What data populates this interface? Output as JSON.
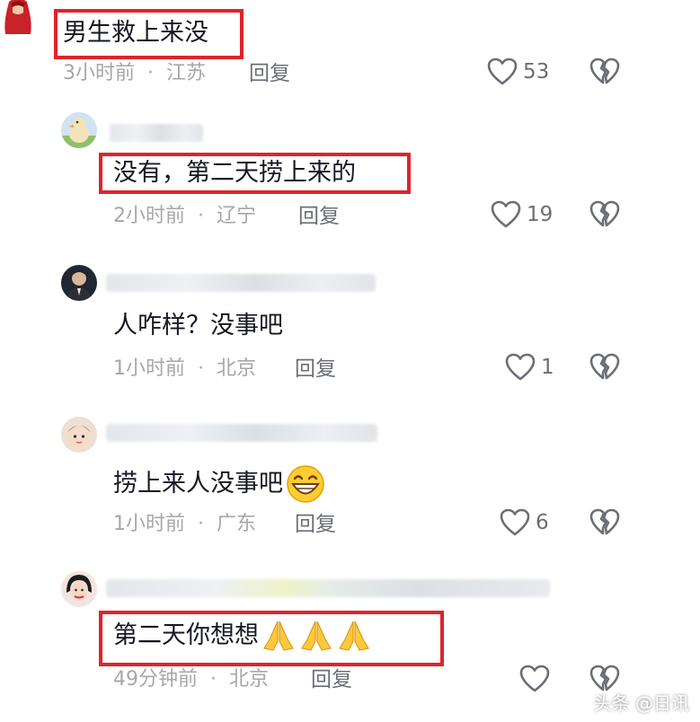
{
  "comments": [
    {
      "text": "男生救上来没",
      "time": "3小时前",
      "location": "江苏",
      "reply_label": "回复",
      "likes": "53"
    },
    {
      "text": "没有，第二天捞上来的",
      "time": "2小时前",
      "location": "辽宁",
      "reply_label": "回复",
      "likes": "19"
    },
    {
      "text": "人咋样？没事吧",
      "time": "1小时前",
      "location": "北京",
      "reply_label": "回复",
      "likes": "1"
    },
    {
      "text": "捞上来人没事吧",
      "time": "1小时前",
      "location": "广东",
      "reply_label": "回复",
      "likes": "6"
    },
    {
      "text": "第二天你想想",
      "time": "49分钟前",
      "location": "北京",
      "reply_label": "回复",
      "likes": ""
    }
  ],
  "meta_separator": "·",
  "watermark": "头条 @日讯",
  "colors": {
    "highlight_box": "#e0232b",
    "meta_gray": "#a5a7ad",
    "text": "#161823"
  },
  "icons": [
    "heart-outline-icon",
    "broken-heart-icon",
    "grin-emoji-icon",
    "pray-emoji-icon"
  ]
}
